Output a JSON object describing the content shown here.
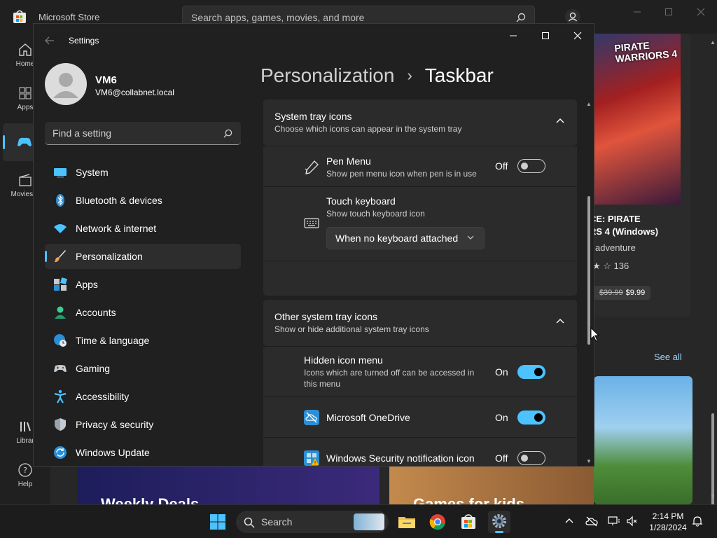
{
  "store": {
    "app_title": "Microsoft Store",
    "search_placeholder": "Search apps, games, movies, and more",
    "rail": [
      {
        "label": "Home"
      },
      {
        "label": "Apps"
      },
      {
        "label": ""
      },
      {
        "label": "Movies &"
      },
      {
        "label": "Librar"
      },
      {
        "label": "Help"
      }
    ],
    "game": {
      "logo_text": "PIRATE WARRIORS 4",
      "title_line1": "CE: PIRATE",
      "title_line2": "RS 4 (Windows)",
      "genre": "adventure",
      "rating": "136",
      "old_price": "$39.99",
      "price": "$9.99"
    },
    "see_all": "See all",
    "deals_heading": "Weekly Deals",
    "kids_heading": "Games for kids"
  },
  "settings": {
    "window_title": "Settings",
    "profile": {
      "name": "VM6",
      "email": "VM6@collabnet.local"
    },
    "search_placeholder": "Find a setting",
    "nav": [
      {
        "label": "System",
        "icon": "system-icon"
      },
      {
        "label": "Bluetooth & devices",
        "icon": "bluetooth-icon"
      },
      {
        "label": "Network & internet",
        "icon": "wifi-icon"
      },
      {
        "label": "Personalization",
        "icon": "brush-icon",
        "active": true
      },
      {
        "label": "Apps",
        "icon": "apps-icon"
      },
      {
        "label": "Accounts",
        "icon": "accounts-icon"
      },
      {
        "label": "Time & language",
        "icon": "globe-clock-icon"
      },
      {
        "label": "Gaming",
        "icon": "gamepad-icon"
      },
      {
        "label": "Accessibility",
        "icon": "accessibility-icon"
      },
      {
        "label": "Privacy & security",
        "icon": "shield-icon"
      },
      {
        "label": "Windows Update",
        "icon": "update-icon"
      }
    ],
    "breadcrumb": {
      "parent": "Personalization",
      "separator": "›",
      "current": "Taskbar"
    },
    "system_tray": {
      "title": "System tray icons",
      "subtitle": "Choose which icons can appear in the system tray",
      "pen_menu": {
        "title": "Pen Menu",
        "subtitle": "Show pen menu icon when pen is in use",
        "state": "Off"
      },
      "touch_keyboard": {
        "title": "Touch keyboard",
        "subtitle": "Show touch keyboard icon",
        "dropdown_value": "When no keyboard attached"
      }
    },
    "other_tray": {
      "title": "Other system tray icons",
      "subtitle": "Show or hide additional system tray icons",
      "hidden_menu": {
        "title": "Hidden icon menu",
        "subtitle_line1": "Icons which are turned off can be accessed in",
        "subtitle_line2": "this menu",
        "state": "On"
      },
      "onedrive": {
        "title": "Microsoft OneDrive",
        "state": "On"
      },
      "security": {
        "title": "Windows Security notification icon",
        "state": "Off"
      }
    }
  },
  "taskbar": {
    "search_label": "Search",
    "time": "2:14 PM",
    "date": "1/28/2024"
  },
  "colors": {
    "accent": "#4cc2ff",
    "window_bg": "#202020",
    "card_bg": "#2b2b2b"
  }
}
